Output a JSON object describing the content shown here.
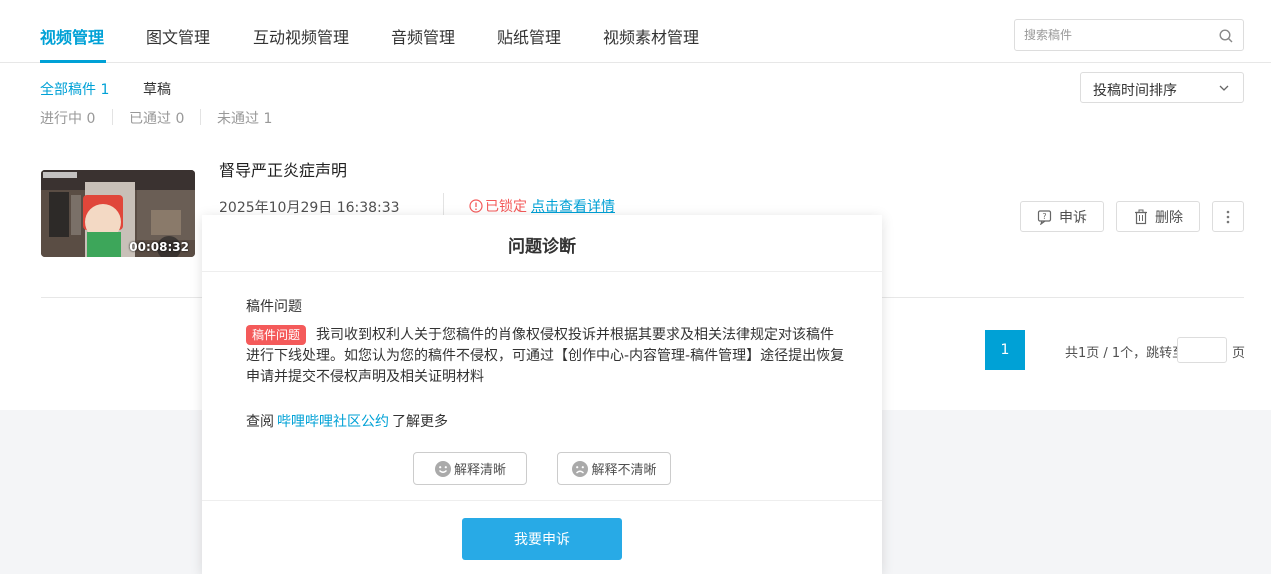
{
  "tabs": [
    {
      "label": "视频管理",
      "active": true
    },
    {
      "label": "图文管理"
    },
    {
      "label": "互动视频管理"
    },
    {
      "label": "音频管理"
    },
    {
      "label": "贴纸管理"
    },
    {
      "label": "视频素材管理"
    }
  ],
  "search": {
    "placeholder": "搜索稿件"
  },
  "filters": {
    "all": "全部稿件 1",
    "draft": "草稿"
  },
  "status": {
    "in_progress": "进行中 0",
    "passed": "已通过 0",
    "rejected": "未通过 1"
  },
  "sort": {
    "label": "投稿时间排序"
  },
  "video": {
    "title": "督导严正炎症声明",
    "time": "2025年10月29日 16:38:33",
    "duration": "00:08:32",
    "locked_label": "已锁定",
    "detail_link": "点击查看详情"
  },
  "actions": {
    "appeal": "申诉",
    "delete": "删除"
  },
  "pagination": {
    "current": "1",
    "info": "共1页 / 1个，跳转至",
    "unit": "页"
  },
  "modal": {
    "title": "问题诊断",
    "section_label": "稿件问题",
    "tag": "稿件问题",
    "issue_text": "我司收到权利人关于您稿件的肖像权侵权投诉并根据其要求及相关法律规定对该稿件进行下线处理。如您认为您的稿件不侵权，可通过【创作中心-内容管理-稿件管理】途径提出恢复申请并提交不侵权声明及相关证明材料",
    "refer_prefix": "查阅",
    "refer_link": "哔哩哔哩社区公约",
    "refer_suffix": "了解更多",
    "clear_label": "解释清晰",
    "unclear_label": "解释不清晰",
    "appeal_button": "我要申诉"
  },
  "colors": {
    "accent": "#00a1d6",
    "danger": "#f45a5a",
    "button": "#28aae6"
  }
}
